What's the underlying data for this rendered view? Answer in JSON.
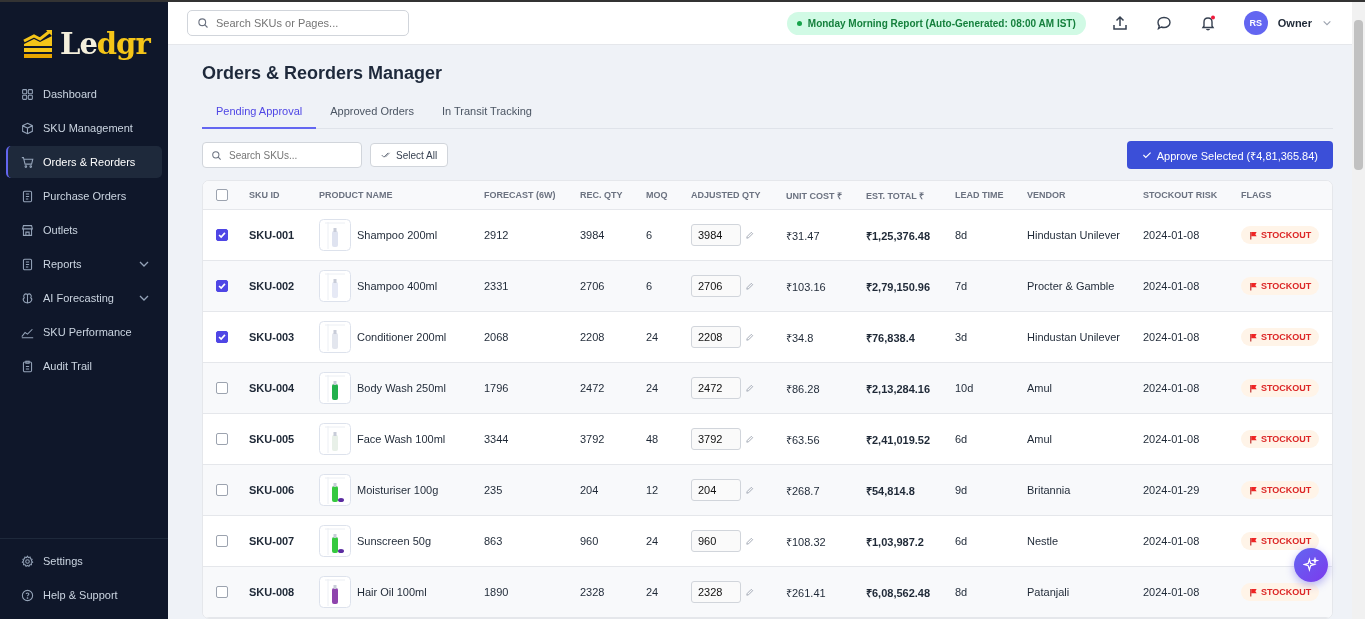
{
  "logo": {
    "parts": [
      "Le",
      "dgr"
    ]
  },
  "sidebar": {
    "items": [
      {
        "label": "Dashboard",
        "selected": false
      },
      {
        "label": "SKU Management",
        "selected": false
      },
      {
        "label": "Orders & Reorders",
        "selected": true
      },
      {
        "label": "Purchase Orders",
        "selected": false
      },
      {
        "label": "Outlets",
        "selected": false
      },
      {
        "label": "Reports",
        "selected": false,
        "expanded": false
      },
      {
        "label": "AI Forecasting",
        "selected": false,
        "expanded": false
      },
      {
        "label": "SKU Performance",
        "selected": false
      },
      {
        "label": "Audit Trail",
        "selected": false
      }
    ],
    "footer": [
      {
        "label": "Settings"
      },
      {
        "label": "Help & Support"
      }
    ]
  },
  "topbar": {
    "search": {
      "placeholder": "Search SKUs or Pages..."
    },
    "report_pill": "Monday Morning Report (Auto-Generated: 08:00 AM IST)",
    "notifications_unread": true,
    "avatar": "RS",
    "user": "Owner"
  },
  "page": {
    "title": "Orders & Reorders Manager",
    "tabs": [
      {
        "label": "Pending Approval",
        "selected": true
      },
      {
        "label": "Approved Orders",
        "selected": false
      },
      {
        "label": "In Transit Tracking",
        "selected": false
      }
    ],
    "search": {
      "placeholder": "Search SKUs..."
    },
    "select_all": "Select All",
    "approve_button": "Approve Selected (₹4,81,365.84)"
  },
  "table": {
    "all_checked": false,
    "columns": [
      "SKU ID",
      "PRODUCT NAME",
      "FORECAST (6W)",
      "REC. QTY",
      "MOQ",
      "ADJUSTED QTY",
      "UNIT COST ₹",
      "EST. TOTAL ₹",
      "LEAD TIME",
      "VENDOR",
      "STOCKOUT RISK",
      "FLAGS"
    ],
    "rows": [
      {
        "checked": true,
        "sku": "SKU-001",
        "product": "Shampoo 200ml",
        "forecast": "2912",
        "rec_qty": "3984",
        "moq": "6",
        "adjusted_qty": "3984",
        "unit_cost": "₹31.47",
        "est_total": "₹1,25,376.48",
        "lead_time": "8d",
        "vendor": "Hindustan Unilever",
        "stockout_risk": "2024-01-08",
        "flag": "STOCKOUT"
      },
      {
        "checked": true,
        "sku": "SKU-002",
        "product": "Shampoo 400ml",
        "forecast": "2331",
        "rec_qty": "2706",
        "moq": "6",
        "adjusted_qty": "2706",
        "unit_cost": "₹103.16",
        "est_total": "₹2,79,150.96",
        "lead_time": "7d",
        "vendor": "Procter & Gamble",
        "stockout_risk": "2024-01-08",
        "flag": "STOCKOUT"
      },
      {
        "checked": true,
        "sku": "SKU-003",
        "product": "Conditioner 200ml",
        "forecast": "2068",
        "rec_qty": "2208",
        "moq": "24",
        "adjusted_qty": "2208",
        "unit_cost": "₹34.8",
        "est_total": "₹76,838.4",
        "lead_time": "3d",
        "vendor": "Hindustan Unilever",
        "stockout_risk": "2024-01-08",
        "flag": "STOCKOUT"
      },
      {
        "checked": false,
        "sku": "SKU-004",
        "product": "Body Wash 250ml",
        "forecast": "1796",
        "rec_qty": "2472",
        "moq": "24",
        "adjusted_qty": "2472",
        "unit_cost": "₹86.28",
        "est_total": "₹2,13,284.16",
        "lead_time": "10d",
        "vendor": "Amul",
        "stockout_risk": "2024-01-08",
        "flag": "STOCKOUT"
      },
      {
        "checked": false,
        "sku": "SKU-005",
        "product": "Face Wash 100ml",
        "forecast": "3344",
        "rec_qty": "3792",
        "moq": "48",
        "adjusted_qty": "3792",
        "unit_cost": "₹63.56",
        "est_total": "₹2,41,019.52",
        "lead_time": "6d",
        "vendor": "Amul",
        "stockout_risk": "2024-01-08",
        "flag": "STOCKOUT"
      },
      {
        "checked": false,
        "sku": "SKU-006",
        "product": "Moisturiser 100g",
        "forecast": "235",
        "rec_qty": "204",
        "moq": "12",
        "adjusted_qty": "204",
        "unit_cost": "₹268.7",
        "est_total": "₹54,814.8",
        "lead_time": "9d",
        "vendor": "Britannia",
        "stockout_risk": "2024-01-29",
        "flag": "STOCKOUT"
      },
      {
        "checked": false,
        "sku": "SKU-007",
        "product": "Sunscreen 50g",
        "forecast": "863",
        "rec_qty": "960",
        "moq": "24",
        "adjusted_qty": "960",
        "unit_cost": "₹108.32",
        "est_total": "₹1,03,987.2",
        "lead_time": "6d",
        "vendor": "Nestle",
        "stockout_risk": "2024-01-08",
        "flag": "STOCKOUT"
      },
      {
        "checked": false,
        "sku": "SKU-008",
        "product": "Hair Oil 100ml",
        "forecast": "1890",
        "rec_qty": "2328",
        "moq": "24",
        "adjusted_qty": "2328",
        "unit_cost": "₹261.41",
        "est_total": "₹6,08,562.48",
        "lead_time": "8d",
        "vendor": "Patanjali",
        "stockout_risk": "2024-01-08",
        "flag": "STOCKOUT"
      }
    ]
  }
}
